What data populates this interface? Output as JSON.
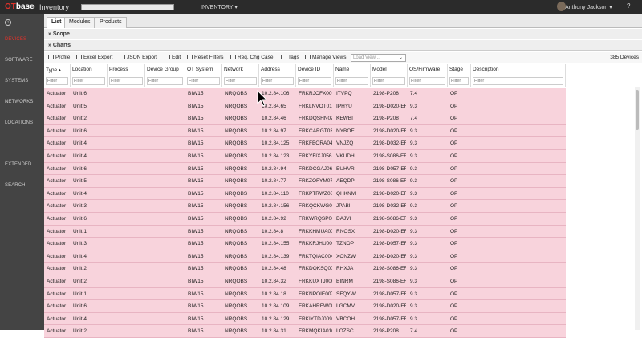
{
  "app": {
    "logo_ot": "OT",
    "logo_base": "base",
    "title": "Inventory",
    "module_menu": "INVENTORY ▾",
    "user": "Anthony Jackson ▾",
    "help": "?"
  },
  "sidebar": {
    "items": [
      {
        "label": "DEVICES",
        "active": true
      },
      {
        "label": "SOFTWARE"
      },
      {
        "label": "SYSTEMS"
      },
      {
        "label": "NETWORKS"
      },
      {
        "label": "LOCATIONS"
      },
      {
        "label": "EXTENDED"
      },
      {
        "label": "SEARCH"
      }
    ]
  },
  "tabs": [
    "List",
    "Modules",
    "Products"
  ],
  "sections": {
    "scope": "Scope",
    "charts": "Charts"
  },
  "toolbar": {
    "profile": "Profile",
    "excel_export": "Excel Export",
    "json_export": "JSON Export",
    "edit": "Edit",
    "reset_filters": "Reset Filters",
    "req_chg_case": "Req. Chg Case",
    "tags": "Tags",
    "manage_views": "Manage Views",
    "load_view_placeholder": "Load View ...",
    "device_count": "385 Devices"
  },
  "columns": [
    "Type ▴",
    "Location",
    "Process",
    "Device Group",
    "OT System",
    "Network",
    "Address",
    "Device ID",
    "Name",
    "Model",
    "OS/Firmware",
    "Stage",
    "Description"
  ],
  "filter_placeholder": "Filter",
  "rows": [
    [
      "Actuator",
      "Unit 6",
      "",
      "",
      "BIW15",
      "NRQOBS",
      "10.2.84.106",
      "FRKRJOFX001",
      "ITVPQ",
      "2198-P208",
      "7.4",
      "OP",
      ""
    ],
    [
      "Actuator",
      "Unit 5",
      "",
      "",
      "BIW15",
      "NRQOBS",
      "10.2.84.65",
      "FRKLNVOT012",
      "IPHYU",
      "2198-D020-ERS",
      "9.3",
      "OP",
      ""
    ],
    [
      "Actuator",
      "Unit 2",
      "",
      "",
      "BIW15",
      "NRQOBS",
      "10.2.84.46",
      "FRKDQSHN021",
      "KEWBI",
      "2198-P208",
      "7.4",
      "OP",
      ""
    ],
    [
      "Actuator",
      "Unit 6",
      "",
      "",
      "BIW15",
      "NRQOBS",
      "10.2.84.97",
      "FRKCARGT034",
      "NYBOE",
      "2198-D020-ERS",
      "9.3",
      "OP",
      ""
    ],
    [
      "Actuator",
      "Unit 4",
      "",
      "",
      "BIW15",
      "NRQOBS",
      "10.2.84.125",
      "FRKFBORA045",
      "VNJZQ",
      "2198-D032-ERS",
      "9.3",
      "OP",
      ""
    ],
    [
      "Actuator",
      "Unit 4",
      "",
      "",
      "BIW15",
      "NRQOBS",
      "10.2.84.123",
      "FRKYFIXJ056",
      "VKUDH",
      "2198-S086-ERS",
      "9.3",
      "OP",
      ""
    ],
    [
      "Actuator",
      "Unit 6",
      "",
      "",
      "BIW15",
      "NRQOBS",
      "10.2.84.94",
      "FRKDCGAJ067",
      "EUHVR",
      "2198-D057-ERS",
      "9.3",
      "OP",
      ""
    ],
    [
      "Actuator",
      "Unit 5",
      "",
      "",
      "BIW15",
      "NRQOBS",
      "10.2.84.77",
      "FRKZOFYM078",
      "AEQDP",
      "2198-S086-ERS",
      "9.3",
      "OP",
      ""
    ],
    [
      "Actuator",
      "Unit 4",
      "",
      "",
      "BIW15",
      "NRQOBS",
      "10.2.84.110",
      "FRKPTRWZ089",
      "QHKNM",
      "2198-D020-ERS",
      "9.3",
      "OP",
      ""
    ],
    [
      "Actuator",
      "Unit 3",
      "",
      "",
      "BIW15",
      "NRQOBS",
      "10.2.84.156",
      "FRKQCKWG090",
      "JPABI",
      "2198-D032-ERS",
      "9.3",
      "OP",
      ""
    ],
    [
      "Actuator",
      "Unit 6",
      "",
      "",
      "BIW15",
      "NRQOBS",
      "10.2.84.92",
      "FRKWRQSP001",
      "DAJVI",
      "2198-S086-ERS",
      "9.3",
      "OP",
      ""
    ],
    [
      "Actuator",
      "Unit 1",
      "",
      "",
      "BIW15",
      "NRQOBS",
      "10.2.84.8",
      "FRKKHMUA002",
      "RNOSX",
      "2198-D020-ERS",
      "9.3",
      "OP",
      ""
    ],
    [
      "Actuator",
      "Unit 3",
      "",
      "",
      "BIW15",
      "NRQOBS",
      "10.2.84.155",
      "FRKKRJHU003",
      "TZNOP",
      "2198-D057-ERS",
      "9.3",
      "OP",
      ""
    ],
    [
      "Actuator",
      "Unit 4",
      "",
      "",
      "BIW15",
      "NRQOBS",
      "10.2.84.139",
      "FRKTQIAC004",
      "XONZW",
      "2198-D020-ERS",
      "9.3",
      "OP",
      ""
    ],
    [
      "Actuator",
      "Unit 2",
      "",
      "",
      "BIW15",
      "NRQOBS",
      "10.2.84.48",
      "FRKDQKSQ005",
      "RHXJA",
      "2198-S086-ERS",
      "9.3",
      "OP",
      ""
    ],
    [
      "Actuator",
      "Unit 2",
      "",
      "",
      "BIW15",
      "NRQOBS",
      "10.2.84.32",
      "FRKKUXTJ006",
      "BINRM",
      "2198-S086-ERS",
      "9.3",
      "OP",
      ""
    ],
    [
      "Actuator",
      "Unit 1",
      "",
      "",
      "BIW15",
      "NRQOBS",
      "10.2.84.18",
      "FRKNPOIE007",
      "SFQYW",
      "2198-D057-ERS",
      "9.3",
      "OP",
      ""
    ],
    [
      "Actuator",
      "Unit 6",
      "",
      "",
      "BIW15",
      "NRQOBS",
      "10.2.84.109",
      "FRKAHREW008",
      "LGCMV",
      "2198-D020-ERS",
      "9.3",
      "OP",
      ""
    ],
    [
      "Actuator",
      "Unit 4",
      "",
      "",
      "BIW15",
      "NRQOBS",
      "10.2.84.129",
      "FRKIYTDJ009",
      "VBCOH",
      "2198-D057-ERS",
      "9.3",
      "OP",
      ""
    ],
    [
      "Actuator",
      "Unit 2",
      "",
      "",
      "BIW15",
      "NRQOBS",
      "10.2.84.31",
      "FRKMQKIA010",
      "LOZSC",
      "2198-P208",
      "7.4",
      "OP",
      ""
    ]
  ]
}
